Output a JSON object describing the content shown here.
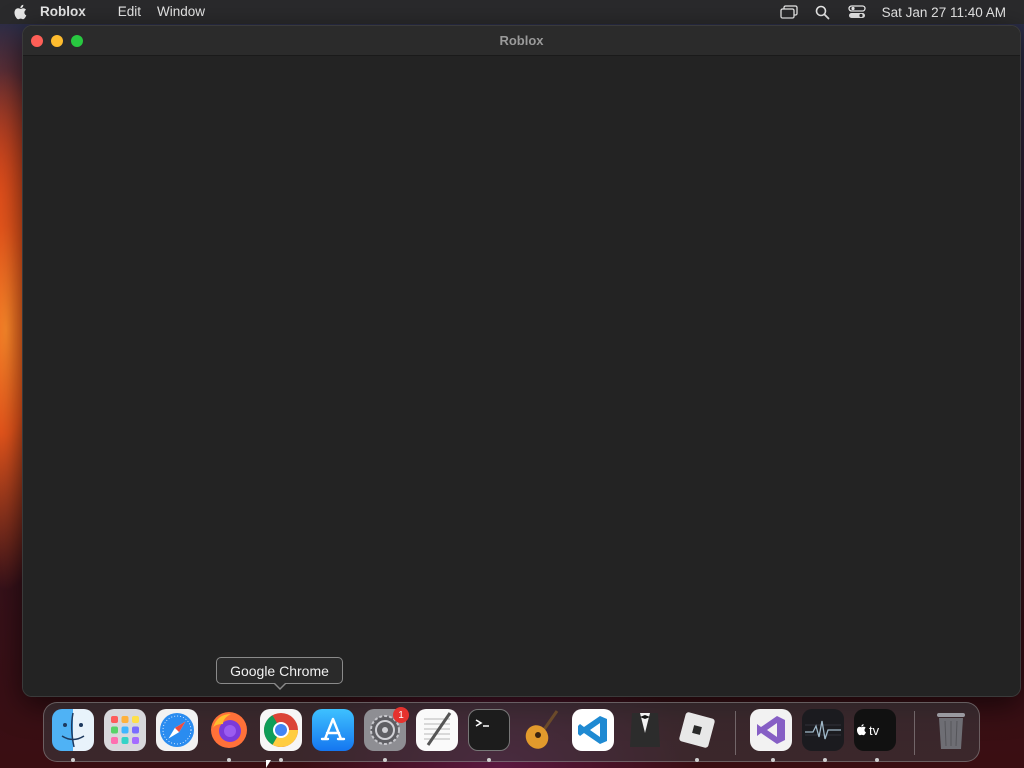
{
  "menubar": {
    "app_name": "Roblox",
    "items": [
      "Edit",
      "Window"
    ],
    "datetime": "Sat Jan 27  11:40 AM"
  },
  "window": {
    "title": "Roblox"
  },
  "tooltip": {
    "text": "Google Chrome"
  },
  "dock": {
    "items": [
      {
        "name": "Finder",
        "icon": "finder-icon",
        "running": true
      },
      {
        "name": "Launchpad",
        "icon": "launchpad-icon",
        "running": false
      },
      {
        "name": "Safari",
        "icon": "safari-icon",
        "running": false
      },
      {
        "name": "Firefox",
        "icon": "firefox-icon",
        "running": true
      },
      {
        "name": "Google Chrome",
        "icon": "chrome-icon",
        "running": true
      },
      {
        "name": "App Store",
        "icon": "app-store-icon",
        "running": false
      },
      {
        "name": "System Settings",
        "icon": "system-settings-icon",
        "running": true,
        "badge": "1"
      },
      {
        "name": "TextEdit",
        "icon": "textedit-icon",
        "running": false
      },
      {
        "name": "Terminal",
        "icon": "terminal-icon",
        "running": true
      },
      {
        "name": "GarageBand",
        "icon": "garageband-icon",
        "running": false
      },
      {
        "name": "Visual Studio Code",
        "icon": "vscode-icon",
        "running": false
      },
      {
        "name": "Bartender",
        "icon": "bartender-icon",
        "running": false
      },
      {
        "name": "Roblox",
        "icon": "roblox-icon",
        "running": true
      },
      {
        "name": "Visual Studio",
        "icon": "visual-studio-icon",
        "running": true
      },
      {
        "name": "Activity Monitor",
        "icon": "activity-monitor-icon",
        "running": true
      },
      {
        "name": "Apple TV",
        "icon": "apple-tv-icon",
        "running": true
      },
      {
        "name": "Trash",
        "icon": "trash-icon",
        "running": false
      }
    ]
  },
  "colors": {
    "menubar_bg": "#2a2a2c",
    "window_bg": "#232323",
    "close": "#fe5f57",
    "minimize": "#febc2e",
    "zoom": "#28c840"
  }
}
